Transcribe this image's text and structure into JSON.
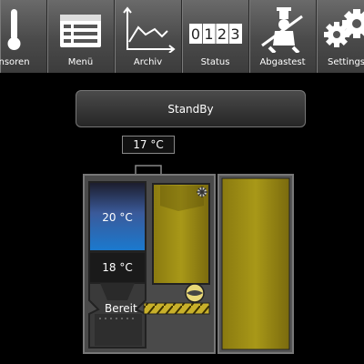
{
  "toolbar": {
    "items": [
      {
        "label": "Sensoren",
        "icon": "thermometer-icon"
      },
      {
        "label": "Menü",
        "icon": "menu-list-icon"
      },
      {
        "label": "Archiv",
        "icon": "chart-icon"
      },
      {
        "label": "Status",
        "icon": "counter-icon",
        "counter": [
          "0",
          "1",
          "2",
          "3"
        ]
      },
      {
        "label": "Abgastest",
        "icon": "chimney-sweep-icon"
      },
      {
        "label": "Settings",
        "icon": "gears-icon"
      }
    ]
  },
  "state": {
    "label": "StandBy"
  },
  "boiler": {
    "top_temp": "17 °C",
    "buffer_temp": "20 °C",
    "lower_temp": "18 °C",
    "ready_label": "Bereit"
  },
  "colors": {
    "accent_blue": "#1a7ad0",
    "pellet": "#9a8a18"
  }
}
